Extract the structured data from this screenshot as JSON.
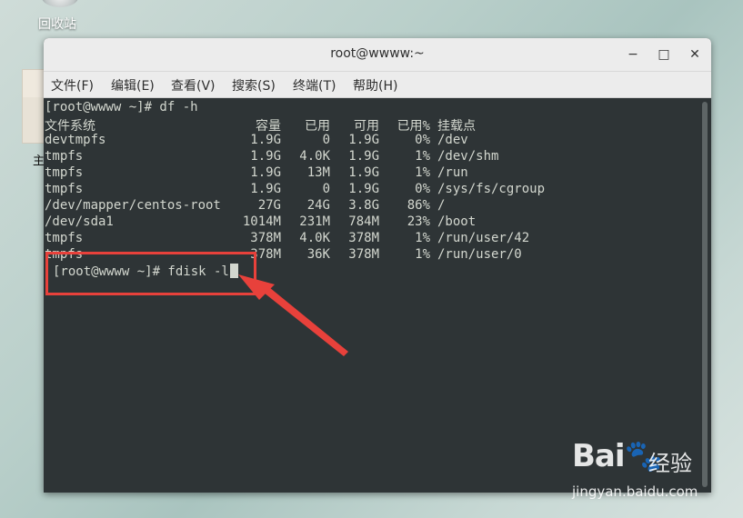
{
  "desktop": {
    "recycle_bin_label": "回收站",
    "partial_char": "主"
  },
  "window": {
    "title": "root@wwww:~",
    "controls": {
      "minimize": "−",
      "maximize": "□",
      "close": "✕"
    },
    "menu": [
      "文件(F)",
      "编辑(E)",
      "查看(V)",
      "搜索(S)",
      "终端(T)",
      "帮助(H)"
    ]
  },
  "terminal": {
    "prompt1": "[root@wwww ~]# df -h",
    "headers": {
      "fs": "文件系统",
      "size": "容量",
      "used": "已用",
      "avail": "可用",
      "pct": "已用%",
      "mount": "挂载点"
    },
    "rows": [
      {
        "fs": "devtmpfs",
        "size": "1.9G",
        "used": "0",
        "avail": "1.9G",
        "pct": "0%",
        "mount": "/dev"
      },
      {
        "fs": "tmpfs",
        "size": "1.9G",
        "used": "4.0K",
        "avail": "1.9G",
        "pct": "1%",
        "mount": "/dev/shm"
      },
      {
        "fs": "tmpfs",
        "size": "1.9G",
        "used": "13M",
        "avail": "1.9G",
        "pct": "1%",
        "mount": "/run"
      },
      {
        "fs": "tmpfs",
        "size": "1.9G",
        "used": "0",
        "avail": "1.9G",
        "pct": "0%",
        "mount": "/sys/fs/cgroup"
      },
      {
        "fs": "/dev/mapper/centos-root",
        "size": "27G",
        "used": "24G",
        "avail": "3.8G",
        "pct": "86%",
        "mount": "/"
      },
      {
        "fs": "/dev/sda1",
        "size": "1014M",
        "used": "231M",
        "avail": "784M",
        "pct": "23%",
        "mount": "/boot"
      },
      {
        "fs": "tmpfs",
        "size": "378M",
        "used": "4.0K",
        "avail": "378M",
        "pct": "1%",
        "mount": "/run/user/42"
      },
      {
        "fs": "tmpfs",
        "size": "378M",
        "used": "36K",
        "avail": "378M",
        "pct": "1%",
        "mount": "/run/user/0"
      }
    ],
    "prompt2": "[root@wwww ~]# fdisk -l"
  },
  "annotation": {
    "color": "#e8413b"
  },
  "watermark": {
    "logo": "Bai🐾",
    "text": "经验",
    "url": "jingyan.baidu.com"
  }
}
